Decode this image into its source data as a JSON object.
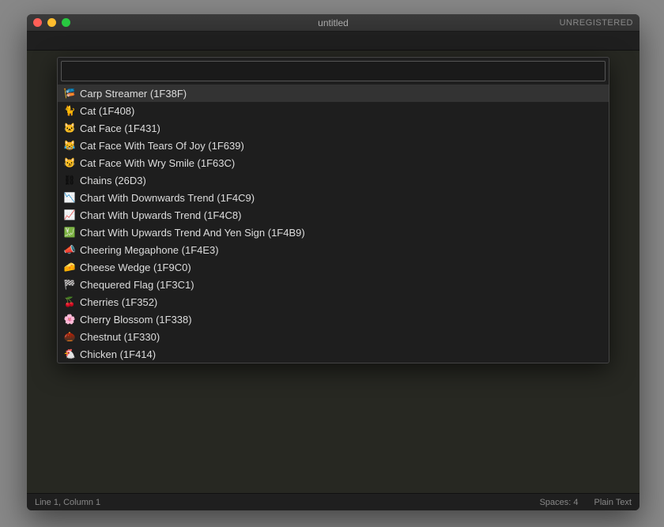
{
  "titlebar": {
    "title": "untitled",
    "unregistered": "UNREGISTERED"
  },
  "palette": {
    "input_value": "",
    "input_placeholder": "",
    "items": [
      {
        "icon": "🎏",
        "label": "Carp Streamer (1F38F)"
      },
      {
        "icon": "🐈",
        "label": "Cat (1F408)"
      },
      {
        "icon": "🐱",
        "label": "Cat Face (1F431)"
      },
      {
        "icon": "😹",
        "label": "Cat Face With Tears Of Joy (1F639)"
      },
      {
        "icon": "😼",
        "label": "Cat Face With Wry Smile (1F63C)"
      },
      {
        "icon": "⛓",
        "label": "Chains (26D3)"
      },
      {
        "icon": "📉",
        "label": "Chart With Downwards Trend (1F4C9)"
      },
      {
        "icon": "📈",
        "label": "Chart With Upwards Trend (1F4C8)"
      },
      {
        "icon": "💹",
        "label": "Chart With Upwards Trend And Yen Sign (1F4B9)"
      },
      {
        "icon": "📣",
        "label": "Cheering Megaphone (1F4E3)"
      },
      {
        "icon": "🧀",
        "label": "Cheese Wedge (1F9C0)"
      },
      {
        "icon": "🏁",
        "label": "Chequered Flag (1F3C1)"
      },
      {
        "icon": "🍒",
        "label": "Cherries (1F352)"
      },
      {
        "icon": "🌸",
        "label": "Cherry Blossom (1F338)"
      },
      {
        "icon": "🌰",
        "label": "Chestnut (1F330)"
      },
      {
        "icon": "🐔",
        "label": "Chicken (1F414)"
      }
    ]
  },
  "statusbar": {
    "position": "Line 1, Column 1",
    "spaces": "Spaces: 4",
    "syntax": "Plain Text"
  }
}
